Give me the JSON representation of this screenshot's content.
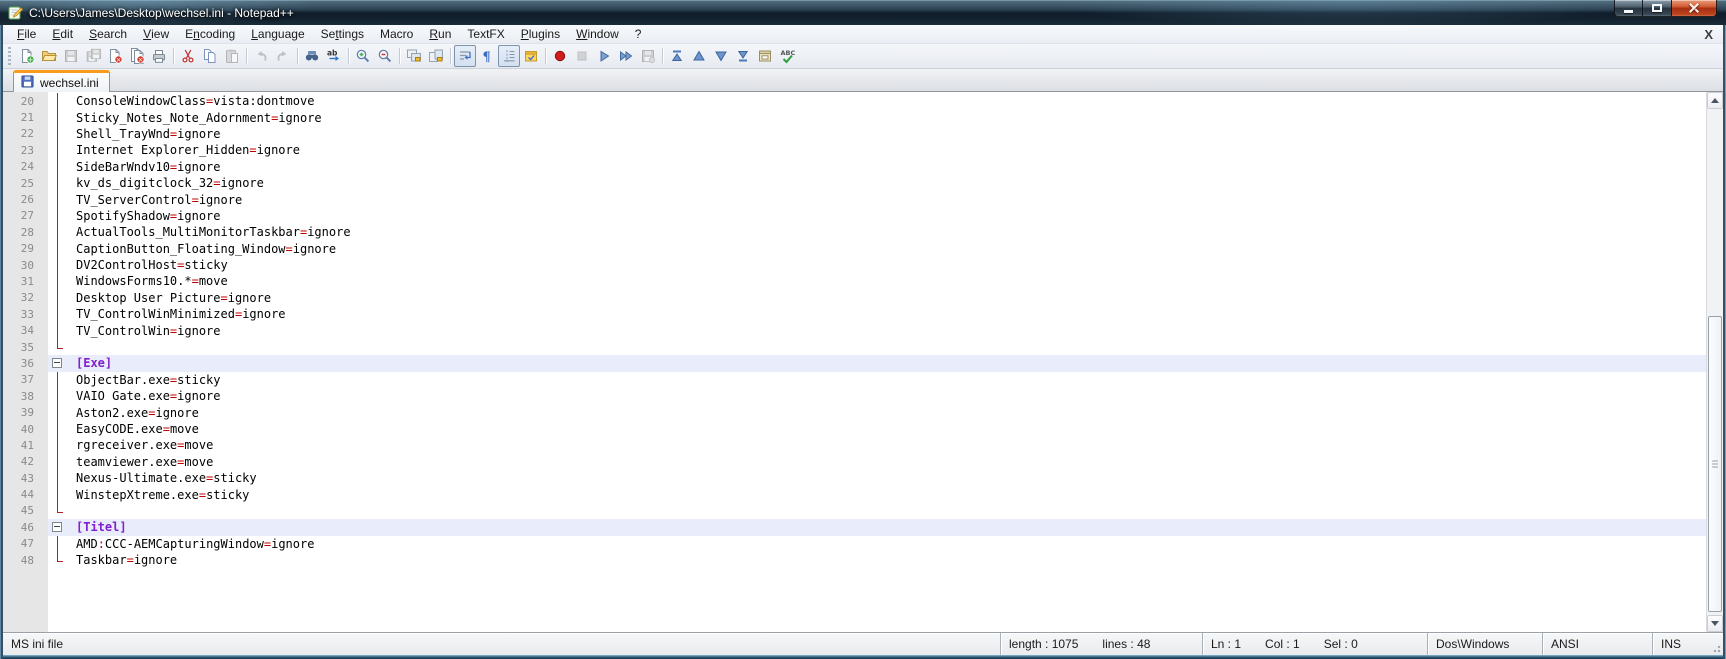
{
  "window": {
    "title": "C:\\Users\\James\\Desktop\\wechsel.ini - Notepad++"
  },
  "menu": {
    "items": [
      {
        "id": "file",
        "label": "File",
        "accel": 0
      },
      {
        "id": "edit",
        "label": "Edit",
        "accel": 0
      },
      {
        "id": "search",
        "label": "Search",
        "accel": 0
      },
      {
        "id": "view",
        "label": "View",
        "accel": 0
      },
      {
        "id": "encoding",
        "label": "Encoding",
        "accel": 1
      },
      {
        "id": "language",
        "label": "Language",
        "accel": 0
      },
      {
        "id": "settings",
        "label": "Settings",
        "accel": 2
      },
      {
        "id": "macro",
        "label": "Macro",
        "accel": -1
      },
      {
        "id": "run",
        "label": "Run",
        "accel": 0
      },
      {
        "id": "textfx",
        "label": "TextFX",
        "accel": -1
      },
      {
        "id": "plugins",
        "label": "Plugins",
        "accel": 0
      },
      {
        "id": "window",
        "label": "Window",
        "accel": 0
      },
      {
        "id": "help",
        "label": "?",
        "accel": -1
      }
    ],
    "close_x": "X"
  },
  "toolbar": {
    "items": [
      {
        "name": "new-file-button",
        "kind": "new"
      },
      {
        "name": "open-file-button",
        "kind": "open"
      },
      {
        "name": "save-button",
        "kind": "save",
        "disabled": true
      },
      {
        "name": "save-all-button",
        "kind": "saveall",
        "disabled": true
      },
      {
        "name": "close-file-button",
        "kind": "close"
      },
      {
        "name": "close-all-button",
        "kind": "closeall"
      },
      {
        "name": "print-button",
        "kind": "print"
      },
      {
        "kind": "sep"
      },
      {
        "name": "cut-button",
        "kind": "cut"
      },
      {
        "name": "copy-button",
        "kind": "copy"
      },
      {
        "name": "paste-button",
        "kind": "paste",
        "disabled": true
      },
      {
        "kind": "sep"
      },
      {
        "name": "undo-button",
        "kind": "undo",
        "disabled": true
      },
      {
        "name": "redo-button",
        "kind": "redo",
        "disabled": true
      },
      {
        "kind": "sep"
      },
      {
        "name": "find-button",
        "kind": "find"
      },
      {
        "name": "replace-button",
        "kind": "replace"
      },
      {
        "kind": "sep"
      },
      {
        "name": "zoom-in-button",
        "kind": "zoomin"
      },
      {
        "name": "zoom-out-button",
        "kind": "zoomout"
      },
      {
        "kind": "sep"
      },
      {
        "name": "sync-vertical-scroll-button",
        "kind": "syncv"
      },
      {
        "name": "sync-horizontal-scroll-button",
        "kind": "synch"
      },
      {
        "kind": "sep"
      },
      {
        "name": "word-wrap-button",
        "kind": "wordwrap",
        "pressed": true
      },
      {
        "name": "show-all-characters-button",
        "kind": "para"
      },
      {
        "name": "show-indent-guide-button",
        "kind": "indent",
        "pressed": true
      },
      {
        "name": "user-defined-dialog-button",
        "kind": "udl"
      },
      {
        "kind": "sep"
      },
      {
        "name": "record-macro-button",
        "kind": "record"
      },
      {
        "name": "stop-macro-button",
        "kind": "stop",
        "disabled": true
      },
      {
        "name": "play-macro-button",
        "kind": "play"
      },
      {
        "name": "run-macro-multiple-button",
        "kind": "playmulti"
      },
      {
        "name": "save-macro-button",
        "kind": "savemacro",
        "disabled": true
      },
      {
        "kind": "sep"
      },
      {
        "name": "go-to-top-button",
        "kind": "navtop"
      },
      {
        "name": "move-up-button",
        "kind": "navup"
      },
      {
        "name": "move-down-button",
        "kind": "navdown"
      },
      {
        "name": "go-to-bottom-button",
        "kind": "navbottom"
      },
      {
        "name": "docked-panel-button",
        "kind": "panel"
      },
      {
        "name": "spell-check-button",
        "kind": "spell"
      }
    ]
  },
  "tabs": [
    {
      "label": "wechsel.ini",
      "active": true,
      "saved": true
    }
  ],
  "editor": {
    "lines": [
      {
        "n": "20",
        "type": "kv",
        "fold": "line",
        "segs": [
          [
            "k",
            "ConsoleWindowClass"
          ],
          [
            "o",
            "="
          ],
          [
            "v",
            "vista:dontmove"
          ]
        ]
      },
      {
        "n": "21",
        "type": "kv",
        "fold": "line",
        "segs": [
          [
            "k",
            "Sticky_Notes_Note_Adornment"
          ],
          [
            "o",
            "="
          ],
          [
            "v",
            "ignore"
          ]
        ]
      },
      {
        "n": "22",
        "type": "kv",
        "fold": "line",
        "segs": [
          [
            "k",
            "Shell_TrayWnd"
          ],
          [
            "o",
            "="
          ],
          [
            "v",
            "ignore"
          ]
        ]
      },
      {
        "n": "23",
        "type": "kv",
        "fold": "line",
        "segs": [
          [
            "k",
            "Internet Explorer_Hidden"
          ],
          [
            "o",
            "="
          ],
          [
            "v",
            "ignore"
          ]
        ]
      },
      {
        "n": "24",
        "type": "kv",
        "fold": "line",
        "segs": [
          [
            "k",
            "SideBarWndv10"
          ],
          [
            "o",
            "="
          ],
          [
            "v",
            "ignore"
          ]
        ]
      },
      {
        "n": "25",
        "type": "kv",
        "fold": "line",
        "segs": [
          [
            "k",
            "kv_ds_digitclock_32"
          ],
          [
            "o",
            "="
          ],
          [
            "v",
            "ignore"
          ]
        ]
      },
      {
        "n": "26",
        "type": "kv",
        "fold": "line",
        "segs": [
          [
            "k",
            "TV_ServerControl"
          ],
          [
            "o",
            "="
          ],
          [
            "v",
            "ignore"
          ]
        ]
      },
      {
        "n": "27",
        "type": "kv",
        "fold": "line",
        "segs": [
          [
            "k",
            "SpotifyShadow"
          ],
          [
            "o",
            "="
          ],
          [
            "v",
            "ignore"
          ]
        ]
      },
      {
        "n": "28",
        "type": "kv",
        "fold": "line",
        "segs": [
          [
            "k",
            "ActualTools_MultiMonitorTaskbar"
          ],
          [
            "o",
            "="
          ],
          [
            "v",
            "ignore"
          ]
        ]
      },
      {
        "n": "29",
        "type": "kv",
        "fold": "line",
        "segs": [
          [
            "k",
            "CaptionButton_Floating_Window"
          ],
          [
            "o",
            "="
          ],
          [
            "v",
            "ignore"
          ]
        ]
      },
      {
        "n": "30",
        "type": "kv",
        "fold": "line",
        "segs": [
          [
            "k",
            "DV2ControlHost"
          ],
          [
            "o",
            "="
          ],
          [
            "v",
            "sticky"
          ]
        ]
      },
      {
        "n": "31",
        "type": "kv",
        "fold": "line",
        "segs": [
          [
            "k",
            "WindowsForms10.*"
          ],
          [
            "o",
            "="
          ],
          [
            "v",
            "move"
          ]
        ]
      },
      {
        "n": "32",
        "type": "kv",
        "fold": "line",
        "segs": [
          [
            "k",
            "Desktop User Picture"
          ],
          [
            "o",
            "="
          ],
          [
            "v",
            "ignore"
          ]
        ]
      },
      {
        "n": "33",
        "type": "kv",
        "fold": "line",
        "segs": [
          [
            "k",
            "TV_ControlWinMinimized"
          ],
          [
            "o",
            "="
          ],
          [
            "v",
            "ignore"
          ]
        ]
      },
      {
        "n": "34",
        "type": "kv",
        "fold": "line",
        "segs": [
          [
            "k",
            "TV_ControlWin"
          ],
          [
            "o",
            "="
          ],
          [
            "v",
            "ignore"
          ]
        ]
      },
      {
        "n": "35",
        "type": "blank",
        "fold": "end",
        "segs": []
      },
      {
        "n": "36",
        "type": "section",
        "fold": "box",
        "segs": [
          [
            "s",
            "[Exe]"
          ]
        ]
      },
      {
        "n": "37",
        "type": "kv",
        "fold": "line",
        "segs": [
          [
            "k",
            "ObjectBar.exe"
          ],
          [
            "o",
            "="
          ],
          [
            "v",
            "sticky"
          ]
        ]
      },
      {
        "n": "38",
        "type": "kv",
        "fold": "line",
        "segs": [
          [
            "k",
            "VAIO Gate.exe"
          ],
          [
            "o",
            "="
          ],
          [
            "v",
            "ignore"
          ]
        ]
      },
      {
        "n": "39",
        "type": "kv",
        "fold": "line",
        "segs": [
          [
            "k",
            "Aston2.exe"
          ],
          [
            "o",
            "="
          ],
          [
            "v",
            "ignore"
          ]
        ]
      },
      {
        "n": "40",
        "type": "kv",
        "fold": "line",
        "segs": [
          [
            "k",
            "EasyCODE.exe"
          ],
          [
            "o",
            "="
          ],
          [
            "v",
            "move"
          ]
        ]
      },
      {
        "n": "41",
        "type": "kv",
        "fold": "line",
        "segs": [
          [
            "k",
            "rgreceiver.exe"
          ],
          [
            "o",
            "="
          ],
          [
            "v",
            "move"
          ]
        ]
      },
      {
        "n": "42",
        "type": "kv",
        "fold": "line",
        "segs": [
          [
            "k",
            "teamviewer.exe"
          ],
          [
            "o",
            "="
          ],
          [
            "v",
            "move"
          ]
        ]
      },
      {
        "n": "43",
        "type": "kv",
        "fold": "line",
        "segs": [
          [
            "k",
            "Nexus-Ultimate.exe"
          ],
          [
            "o",
            "="
          ],
          [
            "v",
            "sticky"
          ]
        ]
      },
      {
        "n": "44",
        "type": "kv",
        "fold": "line",
        "segs": [
          [
            "k",
            "WinstepXtreme.exe"
          ],
          [
            "o",
            "="
          ],
          [
            "v",
            "sticky"
          ]
        ]
      },
      {
        "n": "45",
        "type": "blank",
        "fold": "end",
        "segs": []
      },
      {
        "n": "46",
        "type": "section",
        "fold": "box",
        "segs": [
          [
            "s",
            "[Titel]"
          ]
        ]
      },
      {
        "n": "47",
        "type": "kv",
        "fold": "line",
        "segs": [
          [
            "k",
            "AMD"
          ],
          [
            "o",
            ":"
          ],
          [
            "k",
            "CCC-AEMCapturingWindow"
          ],
          [
            "o",
            "="
          ],
          [
            "v",
            "ignore"
          ]
        ]
      },
      {
        "n": "48",
        "type": "kv",
        "fold": "end",
        "segs": [
          [
            "k",
            "Taskbar"
          ],
          [
            "o",
            "="
          ],
          [
            "v",
            "ignore"
          ]
        ]
      }
    ]
  },
  "statusbar": {
    "doc_type": "MS ini file",
    "length_label": "length : 1075",
    "lines_label": "lines : 48",
    "ln": "Ln : 1",
    "col": "Col : 1",
    "sel": "Sel : 0",
    "eol": "Dos\\Windows",
    "encoding": "ANSI",
    "insert_mode": "INS"
  },
  "colors": {
    "operator_red": "#c00000",
    "section_purple": "#8020d0",
    "section_line_bg": "#e9ecfa",
    "fold_line_red": "#b22020",
    "active_tab_accent_orange": "#f79a1e",
    "close_button_red": "#eb9c79"
  }
}
